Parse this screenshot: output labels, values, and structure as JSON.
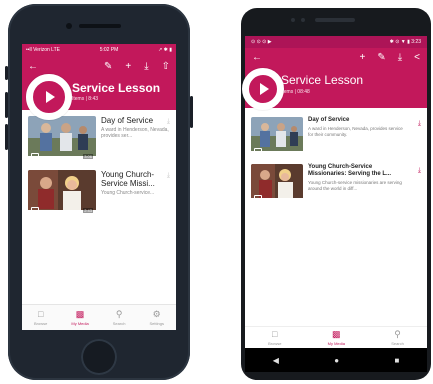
{
  "iphone": {
    "status": {
      "carrier": "••ll Verizon  LTE",
      "time": "5:02 PM",
      "right": "↗ ✱ ▮"
    },
    "toolbar": {
      "back_icon": "back-arrow-icon",
      "edit_icon": "pencil-icon",
      "add_icon": "plus-icon",
      "download_icon": "download-icon",
      "share_icon": "share-icon"
    },
    "header": {
      "title": "Service Lesson",
      "subtitle": "Items | 8:43"
    },
    "items": [
      {
        "title": "Day of Service",
        "desc": "A ward in Henderson, Nevada, provides ser...",
        "duration": "3:06"
      },
      {
        "title": "Young Church-Service Missi...",
        "desc": "Young Church-service...",
        "duration": "2:43"
      }
    ],
    "tabs": [
      {
        "label": "Browse",
        "icon": "book-icon"
      },
      {
        "label": "My Media",
        "icon": "media-icon"
      },
      {
        "label": "Search",
        "icon": "search-icon"
      },
      {
        "label": "Settings",
        "icon": "gear-icon"
      }
    ]
  },
  "android": {
    "status": {
      "left": "⊙ ⊙ ⊙ ▶",
      "time": "3:23",
      "right": "✱ ⊙ ▼ ▮"
    },
    "toolbar": {
      "back_icon": "back-arrow-icon",
      "add_icon": "plus-icon",
      "edit_icon": "pencil-icon",
      "download_icon": "download-icon",
      "share_icon": "share-icon"
    },
    "header": {
      "title": "Service Lesson",
      "subtitle": "Items | 08:48"
    },
    "items": [
      {
        "title": "Day of Service",
        "desc": "A ward in Henderson, Nevada, provides service for their community."
      },
      {
        "title": "Young Church-Service Missionaries: Serving the L...",
        "desc": "Young Church-service missionaries are serving around the world in diff..."
      }
    ],
    "tabs": [
      {
        "label": "Browse",
        "icon": "book-icon"
      },
      {
        "label": "My Media",
        "icon": "media-icon"
      },
      {
        "label": "Search",
        "icon": "search-icon"
      }
    ],
    "nav": {
      "back": "◀",
      "home": "●",
      "recents": "■"
    }
  },
  "colors": {
    "brand": "#c2185b",
    "brand_dark": "#ad1457"
  }
}
